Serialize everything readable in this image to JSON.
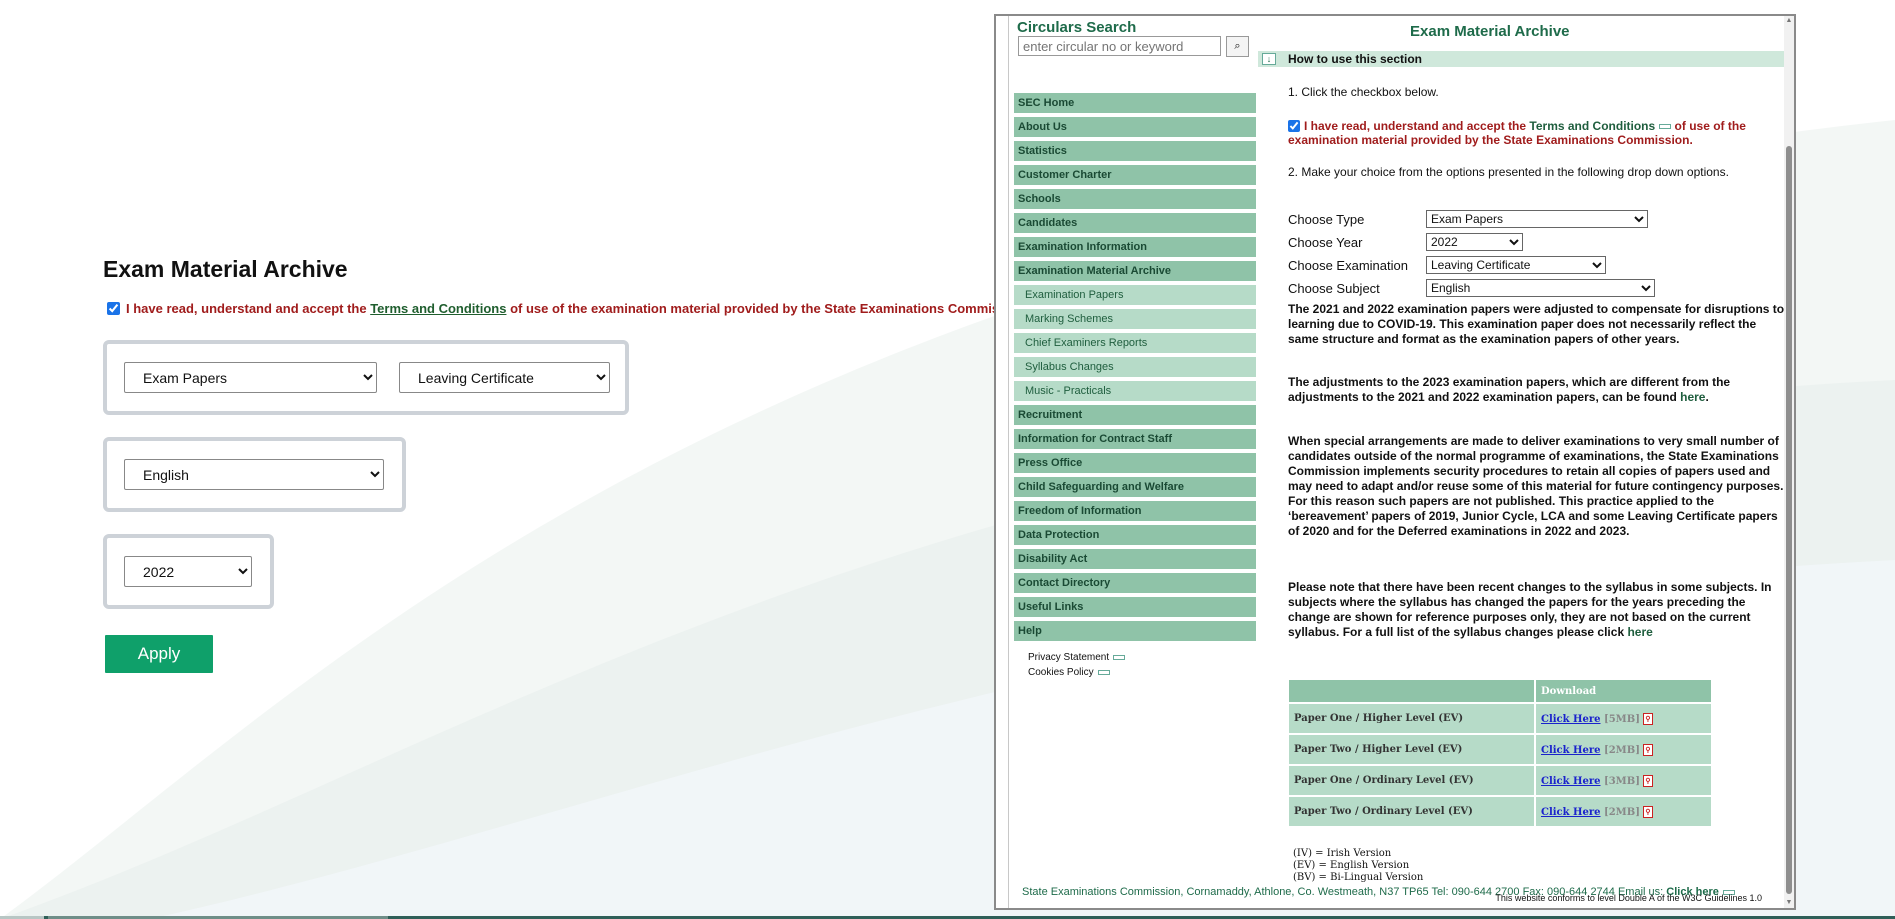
{
  "left_panel": {
    "title": "Exam Material Archive",
    "accept_prefix": "I have read, understand and accept the ",
    "accept_link": "Terms and Conditions",
    "accept_suffix": " of use of the examination material provided by the State Examinations Commission.",
    "type_value": "Exam Papers",
    "exam_value": "Leaving Certificate",
    "subject_value": "English",
    "year_value": "2022",
    "apply_label": "Apply"
  },
  "window": {
    "circulars_title": "Circulars Search",
    "circulars_placeholder": "enter circular no or keyword",
    "circulars_go": "⌕",
    "nav": [
      {
        "label": "SEC Home",
        "sub": false
      },
      {
        "label": "About Us",
        "sub": false
      },
      {
        "label": "Statistics",
        "sub": false
      },
      {
        "label": "Customer Charter",
        "sub": false
      },
      {
        "label": "Schools",
        "sub": false
      },
      {
        "label": "Candidates",
        "sub": false
      },
      {
        "label": "Examination Information",
        "sub": false
      },
      {
        "label": "Examination Material Archive",
        "sub": false
      },
      {
        "label": "Examination Papers",
        "sub": true
      },
      {
        "label": "Marking Schemes",
        "sub": true
      },
      {
        "label": "Chief Examiners Reports",
        "sub": true
      },
      {
        "label": "Syllabus Changes",
        "sub": true
      },
      {
        "label": "Music - Practicals",
        "sub": true
      },
      {
        "label": "Recruitment",
        "sub": false
      },
      {
        "label": "Information for Contract Staff",
        "sub": false
      },
      {
        "label": "Press Office",
        "sub": false
      },
      {
        "label": "Child Safeguarding and Welfare",
        "sub": false
      },
      {
        "label": "Freedom of Information",
        "sub": false
      },
      {
        "label": "Data Protection",
        "sub": false
      },
      {
        "label": "Disability Act",
        "sub": false
      },
      {
        "label": "Contact Directory",
        "sub": false
      },
      {
        "label": "Useful Links",
        "sub": false
      },
      {
        "label": "Help",
        "sub": false
      }
    ],
    "privacy_statement": "Privacy Statement",
    "cookies_policy": "Cookies Policy",
    "archive_title": "Exam Material Archive",
    "howto": "How to use this section",
    "step1": "1. Click the checkbox below.",
    "accept_prefix": "I have read, understand and accept the ",
    "accept_link": "Terms and Conditions",
    "accept_suffix": " of use of the examination material provided by the State Examinations Commission.",
    "step2": "2. Make your choice from the options presented in the following drop down options.",
    "choose_type_label": "Choose Type",
    "choose_type_value": "Exam Papers",
    "choose_year_label": "Choose Year",
    "choose_year_value": "2022",
    "choose_exam_label": "Choose Examination",
    "choose_exam_value": "Leaving Certificate",
    "choose_subject_label": "Choose Subject",
    "choose_subject_value": "English",
    "para1": "The 2021 and 2022 examination papers were adjusted to compensate for disruptions to learning due to COVID-19. This examination paper does not necessarily reflect the same structure and format as the examination papers of other years.",
    "para2_prefix": "The adjustments to the 2023 examination papers, which are different from the adjustments to the 2021 and 2022 examination papers, can be found ",
    "para2_link": "here",
    "para2_suffix": ".",
    "para3": "When special arrangements are made to deliver examinations to very small number of candidates outside of the normal programme of examinations, the State Examinations Commission implements security procedures to retain all copies of papers used and may need to adapt and/or reuse some of this material for future contingency purposes. For this reason such papers are not published. This practice applied to the ‘bereavement’ papers of 2019, Junior Cycle, LCA and some Leaving Certificate papers of 2020 and for the Deferred examinations in 2022 and 2023.",
    "para4_prefix": "Please note that there have been recent changes to the syllabus in some subjects. In subjects where the syllabus has changed the papers for the years preceding the change are shown for reference purposes only, they are not based on the current syllabus. For a full list of the syllabus changes please click ",
    "para4_link": "here",
    "table_header_download": "Download",
    "papers": [
      {
        "name": "Paper One / Higher Level (EV)",
        "link": "Click Here",
        "size": "[5MB]"
      },
      {
        "name": "Paper Two / Higher Level (EV)",
        "link": "Click Here",
        "size": "[2MB]"
      },
      {
        "name": "Paper One / Ordinary Level (EV)",
        "link": "Click Here",
        "size": "[3MB]"
      },
      {
        "name": "Paper Two / Ordinary Level (EV)",
        "link": "Click Here",
        "size": "[2MB]"
      }
    ],
    "legend": [
      "(IV) = Irish Version",
      "(EV) = English Version",
      "(BV) = Bi-Lingual Version"
    ],
    "footer": "State Examinations Commission, Cornamaddy, Athlone, Co. Westmeath, N37 TP65 Tel: 090-644 2700 Fax: 090-644 2744 Email us: ",
    "footer_link": "Click here",
    "footer2": "This website conforms to level Double A of the W3C Guidelines 1.0"
  },
  "colors": {
    "accent_green": "#0fa06a",
    "nav_green": "#8fc3a8",
    "nav_sub_green": "#b6dbc8",
    "accept_red": "#a01c1c",
    "title_green": "#1e6b4a"
  }
}
